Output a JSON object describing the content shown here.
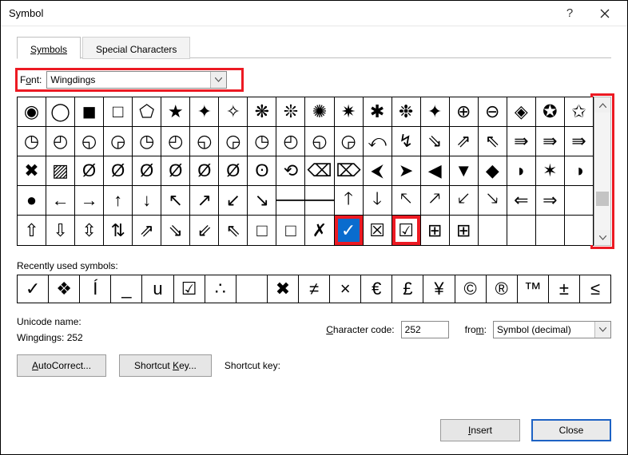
{
  "titlebar": {
    "title": "Symbol"
  },
  "tabs": {
    "symbols": "Symbols",
    "special_chars": "Special Characters"
  },
  "font": {
    "label_pre": "F",
    "label_u": "o",
    "label_post": "nt:",
    "value": "Wingdings"
  },
  "grid": {
    "rows": [
      [
        "◉",
        "◯",
        "◼",
        "□",
        "⬠",
        "★",
        "✦",
        "✧",
        "❋",
        "❊",
        "✺",
        "✷",
        "✱",
        "❉",
        "✦",
        "⊕",
        "⊖",
        "◈",
        "✪",
        "✩"
      ],
      [
        "◷",
        "◴",
        "◵",
        "◶",
        "◷",
        "◴",
        "◵",
        "◶",
        "◷",
        "◴",
        "◵",
        "◶",
        "⤺",
        "↯",
        "⇘",
        "⇗",
        "⇖",
        "⇛",
        "⇛",
        "⇛"
      ],
      [
        "✖",
        "▨",
        "Ø",
        "Ø",
        "Ø",
        "Ø",
        "Ø",
        "Ø",
        "ʘ",
        "⟲",
        "⌫",
        "⌦",
        "⮜",
        "➤",
        "◀",
        "▼",
        "◆",
        "◗",
        "✶",
        "◑"
      ],
      [
        "●",
        "←",
        "→",
        "↑",
        "↓",
        "↖",
        "↗",
        "↙",
        "↘",
        "🡐",
        "🡒",
        "🡑",
        "🡓",
        "🡔",
        "🡕",
        "🡗",
        "🡖",
        "⇐",
        "⇒",
        ""
      ],
      [
        "⇧",
        "⇩",
        "⇳",
        "⇅",
        "⇗",
        "⇘",
        "⇙",
        "⇖",
        "□",
        "□",
        "✗",
        "✓",
        "☒",
        "☑",
        "⊞",
        "⊞",
        "",
        "",
        "",
        ""
      ]
    ],
    "selected": {
      "row": 4,
      "col": 11
    },
    "highlights": [
      {
        "row": 4,
        "col": 11
      },
      {
        "row": 4,
        "col": 13
      }
    ]
  },
  "recent_label": "Recently used symbols:",
  "recent": [
    "✓",
    "❖",
    "Í",
    "_",
    "u",
    "☑",
    "∴",
    "",
    "✖",
    "≠",
    "×",
    "€",
    "£",
    "¥",
    "©",
    "®",
    "™",
    "±",
    "≤"
  ],
  "unicode_name_label": "Unicode name:",
  "unicode_name_value": "Wingdings: 252",
  "charcode": {
    "label_u": "C",
    "label_post": "haracter code:",
    "value": "252"
  },
  "from": {
    "label_u": "m",
    "label_pre": "fro",
    "label_post": ":",
    "value": "Symbol (decimal)"
  },
  "buttons": {
    "autocorrect_u": "A",
    "autocorrect_post": "utoCorrect...",
    "shortcut_pre": "Shortcut ",
    "shortcut_u": "K",
    "shortcut_post": "ey...",
    "shortcut_label": "Shortcut key:",
    "insert_u": "I",
    "insert_post": "nsert",
    "close": "Close"
  }
}
